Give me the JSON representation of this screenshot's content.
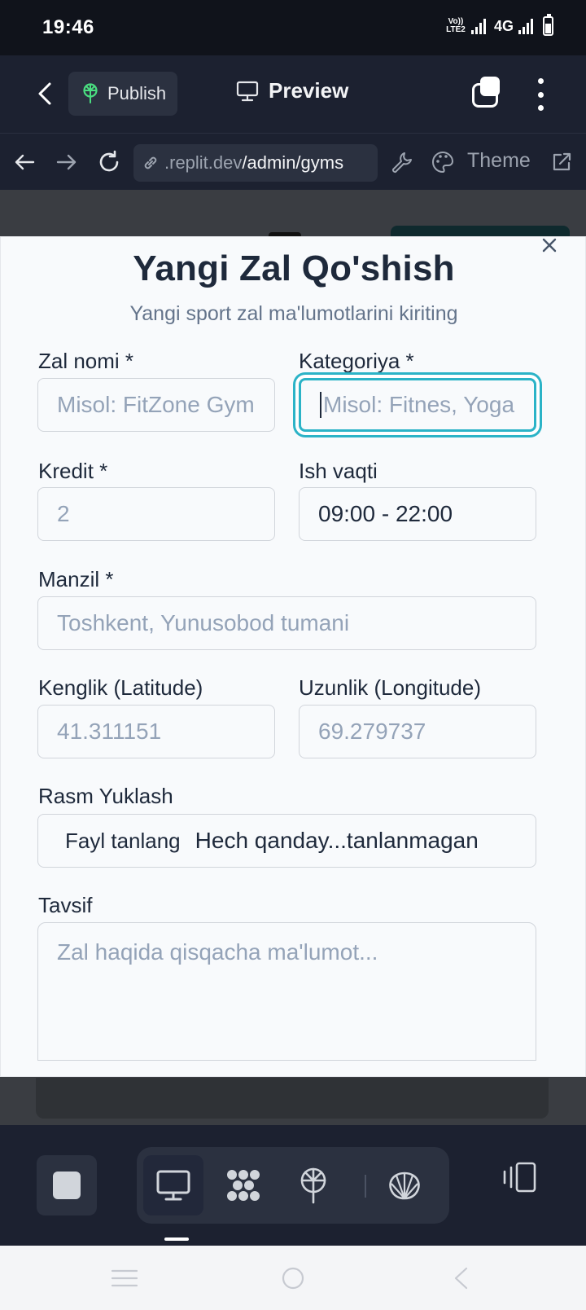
{
  "status_bar": {
    "time": "19:46",
    "volte": "Vo)) LTE2",
    "network": "4G"
  },
  "header": {
    "publish_label": "Publish",
    "preview_label": "Preview"
  },
  "browser": {
    "url_host": ".replit.dev",
    "url_path": "/admin/gyms",
    "theme_label": "Theme"
  },
  "modal": {
    "title": "Yangi Zal Qo'shish",
    "subtitle": "Yangi sport zal ma'lumotlarini kiriting",
    "fields": {
      "name": {
        "label": "Zal nomi *",
        "placeholder": "Misol: FitZone Gym",
        "value": ""
      },
      "category": {
        "label": "Kategoriya *",
        "placeholder": "Misol: Fitnes, Yoga",
        "value": ""
      },
      "credit": {
        "label": "Kredit *",
        "placeholder": "2",
        "value": ""
      },
      "hours": {
        "label": "Ish vaqti",
        "placeholder": "",
        "value": "09:00 - 22:00"
      },
      "address": {
        "label": "Manzil *",
        "placeholder": "Toshkent, Yunusobod tumani",
        "value": ""
      },
      "latitude": {
        "label": "Kenglik (Latitude)",
        "placeholder": "41.311151",
        "value": ""
      },
      "longitude": {
        "label": "Uzunlik (Longitude)",
        "placeholder": "69.279737",
        "value": ""
      },
      "image": {
        "label": "Rasm Yuklash",
        "button": "Fayl tanlang",
        "status": "Hech qanday...tanlanmagan"
      },
      "description": {
        "label": "Tavsif",
        "placeholder": "Zal haqida qisqacha ma'lumot...",
        "value": ""
      }
    },
    "focused_field": "category"
  },
  "colors": {
    "accent_focus": "#2bb3c7",
    "app_bg": "#1c2130",
    "publish_icon": "#4ade80"
  },
  "icons": {
    "back": "chevron-left-icon",
    "publish": "globe-tree-icon",
    "preview": "monitor-icon",
    "tabs": "tabs-icon",
    "more": "more-vertical-icon",
    "nav_back": "arrow-left-icon",
    "nav_forward": "arrow-right-icon",
    "reload": "reload-icon",
    "link": "link-icon",
    "devtools": "wrench-icon",
    "theme": "palette-icon",
    "external": "external-link-icon",
    "close": "close-icon"
  }
}
